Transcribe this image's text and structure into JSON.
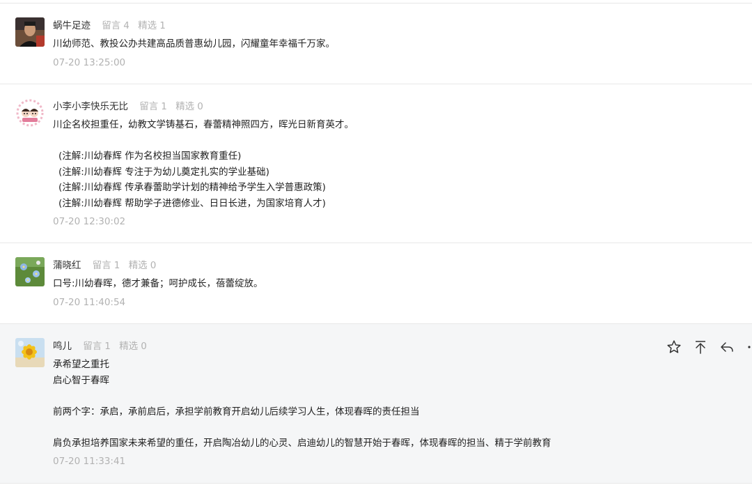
{
  "labels": {
    "comments_label": "留言",
    "picks_label": "精选"
  },
  "comments": [
    {
      "nickname": "蜗牛足迹",
      "comment_count": "4",
      "picks_count": "1",
      "lines": [
        "川幼师范、教投公办共建高品质普惠幼儿园，闪耀童年幸福千万家。"
      ],
      "time": "07-20 13:25:00"
    },
    {
      "nickname": "小李小李快乐无比",
      "comment_count": "1",
      "picks_count": "0",
      "lines": [
        "川企名校担重任，幼教文学铸基石，春蕾精神照四方，晖光日新育英才。",
        "",
        "(注解:川幼春辉 作为名校担当国家教育重任)",
        "(注解:川幼春辉 专注于为幼儿奠定扎实的学业基础)",
        "(注解:川幼春辉 传承春蕾助学计划的精神给予学生入学普惠政策)",
        "(注解:川幼春辉 帮助学子进德修业、日日长进，为国家培育人才)"
      ],
      "time": "07-20 12:30:02"
    },
    {
      "nickname": "蒲晓红",
      "comment_count": "1",
      "picks_count": "0",
      "lines": [
        "口号:川幼春晖，德才兼备；呵护成长，蓓蕾绽放。"
      ],
      "time": "07-20 11:40:54"
    },
    {
      "nickname": "鸣儿",
      "comment_count": "1",
      "picks_count": "0",
      "lines": [
        "承希望之重托",
        "启心智于春晖",
        "",
        "前两个字：承启，承前启后，承担学前教育开启幼儿后续学习人生，体现春晖的责任担当",
        "",
        "肩负承担培养国家未来希望的重任，开启陶冶幼儿的心灵、启迪幼儿的智慧开始于春晖，体现春晖的担当、精于学前教育"
      ],
      "time": "07-20 11:33:41"
    }
  ],
  "actions": [
    "star-icon",
    "pin-top-icon",
    "reply-icon",
    "more-icon"
  ]
}
